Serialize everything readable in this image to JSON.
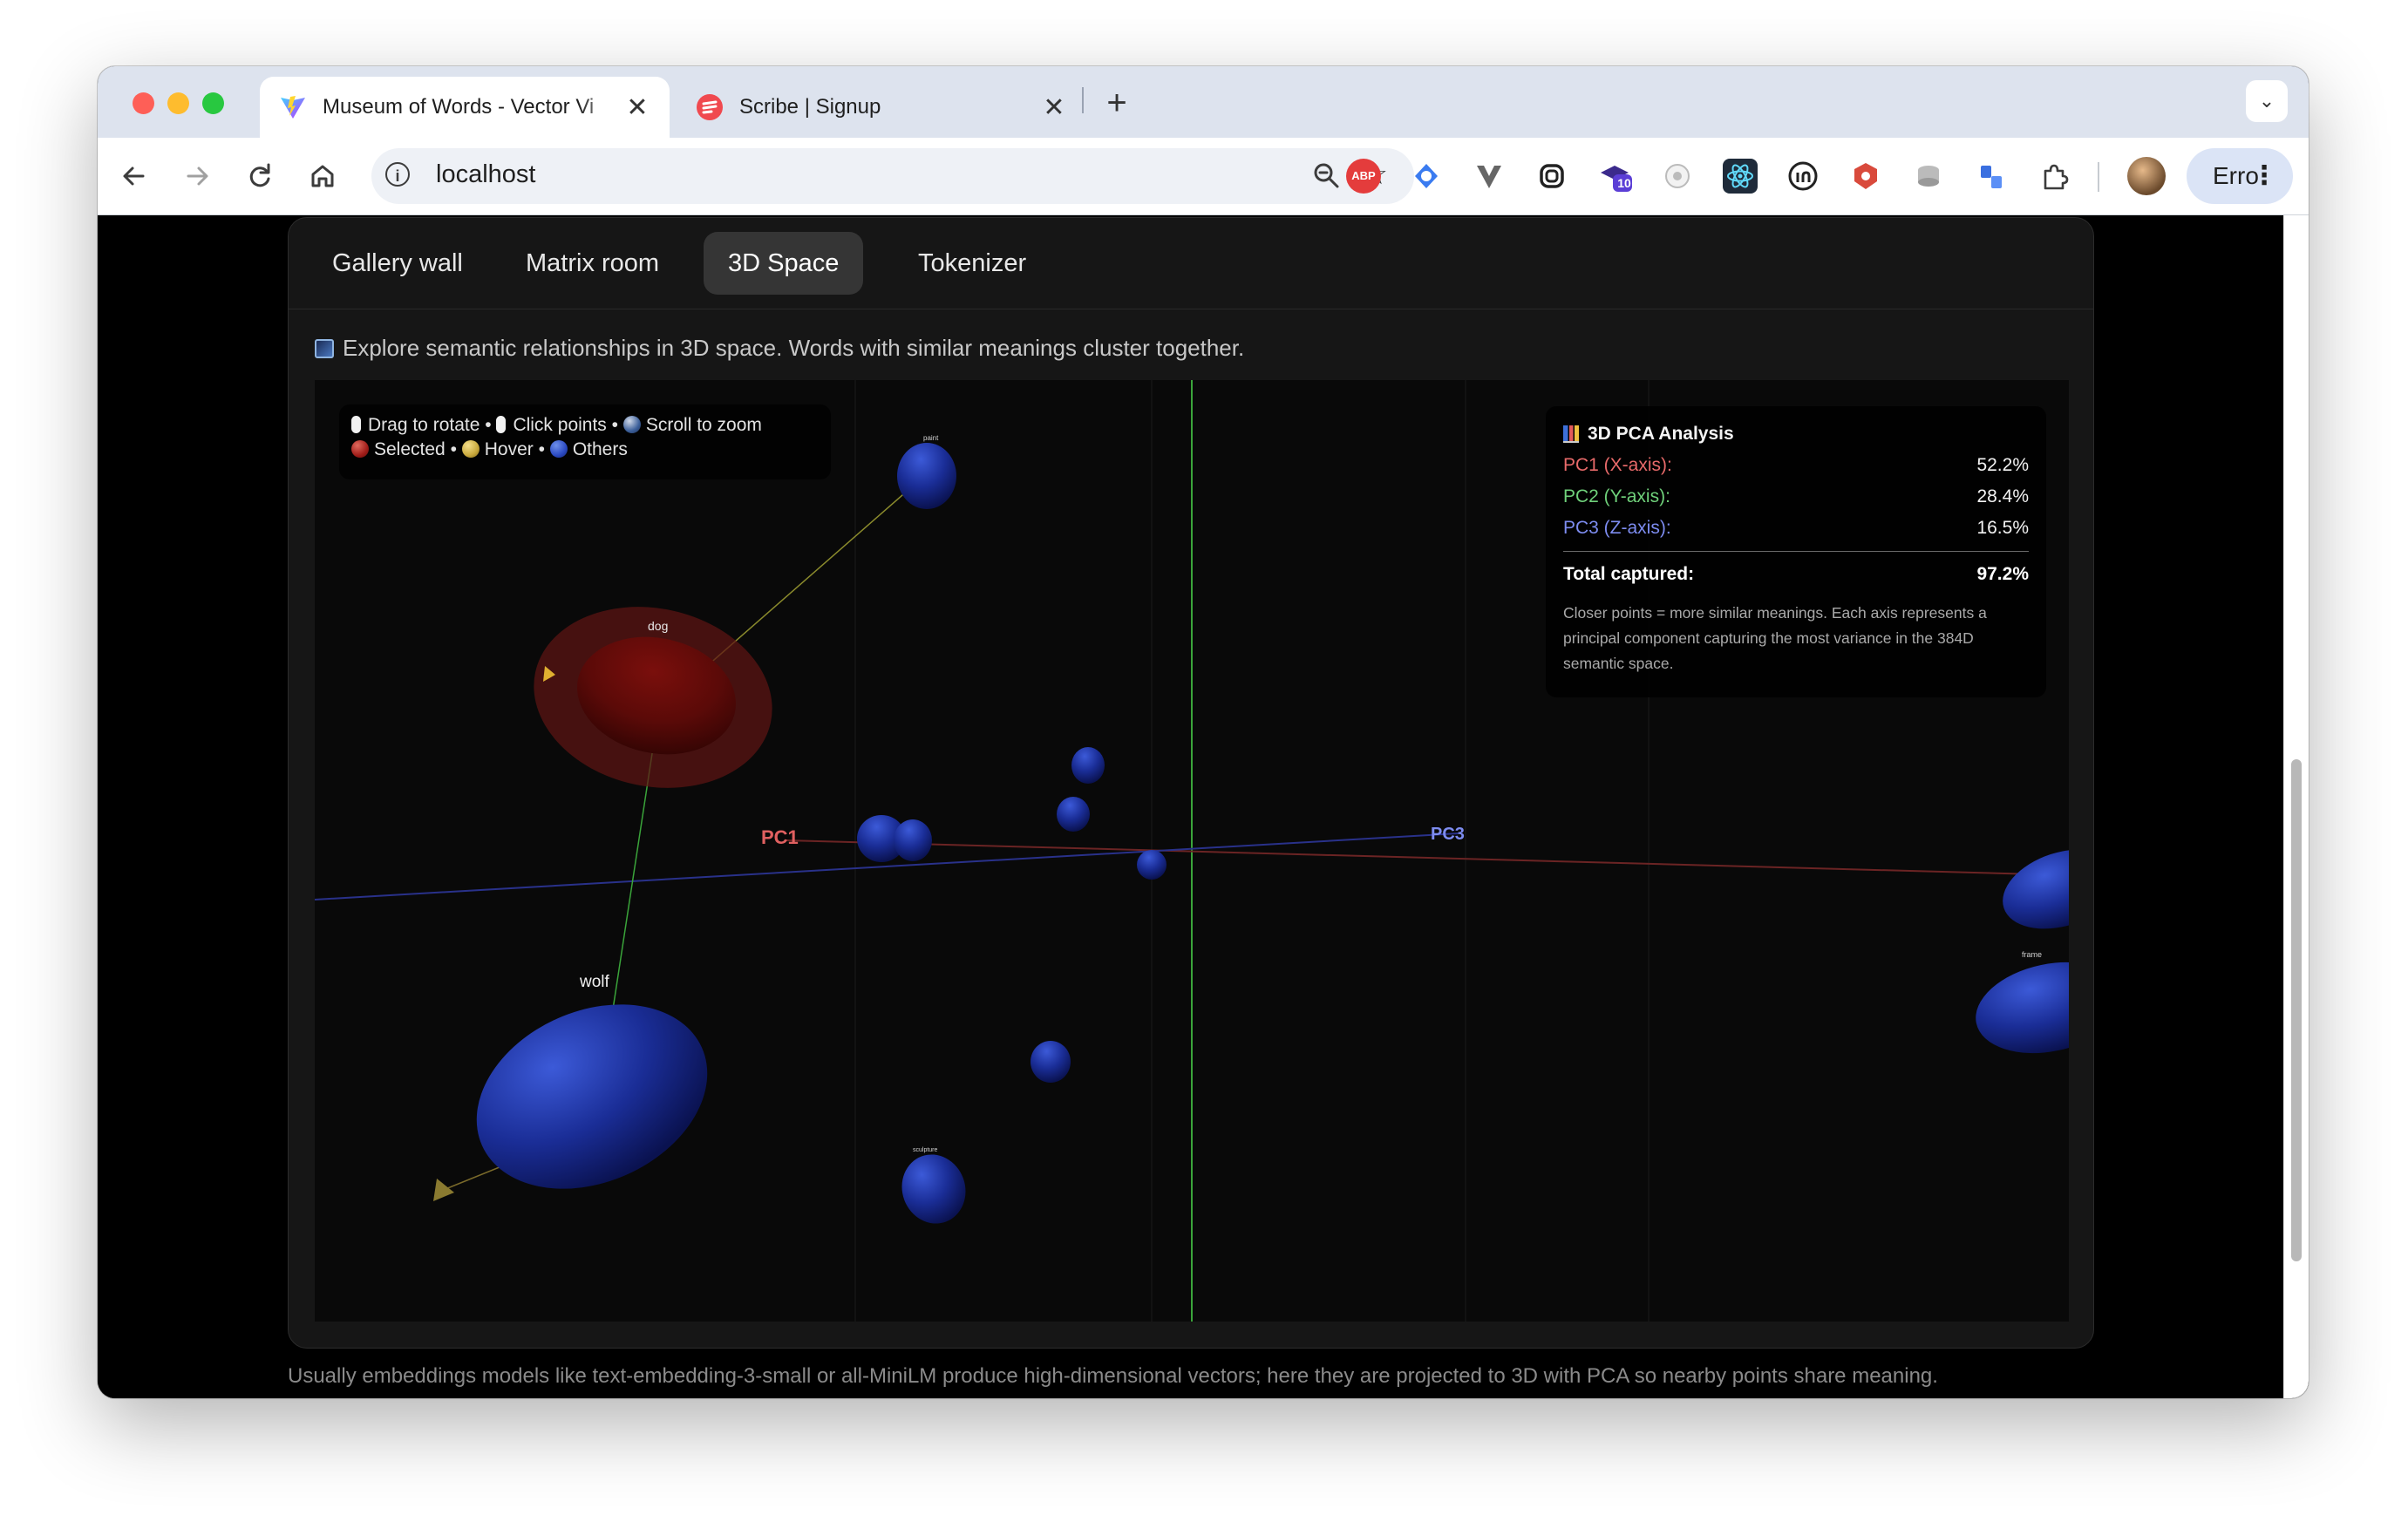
{
  "browser": {
    "tabs": [
      {
        "title": "Museum of Words - Vector Vi",
        "close": "✕",
        "favicon": "vite-icon"
      },
      {
        "title": "Scribe | Signup",
        "close": "✕",
        "favicon": "scribe-icon"
      }
    ],
    "new_tab": "+",
    "tab_search": "⌄",
    "address": "localhost",
    "extension_badge": "10",
    "extensions": [
      "ABP"
    ],
    "profile_name": "Erro",
    "menu": "⋮"
  },
  "app": {
    "tabs": [
      "Gallery wall",
      "Matrix room",
      "3D Space",
      "Tokenizer"
    ],
    "active_tab": "3D Space",
    "description": "Explore semantic relationships in 3D space. Words with similar meanings cluster together.",
    "legend": {
      "line1": [
        "Drag to rotate",
        "Click points",
        "Scroll to zoom"
      ],
      "line2": [
        "Selected",
        "Hover",
        "Others"
      ],
      "sep": " • "
    },
    "pca": {
      "title": "3D PCA Analysis",
      "rows": [
        {
          "label": "PC1 (X-axis):",
          "value": "52.2%",
          "color": "#e86a6a"
        },
        {
          "label": "PC2 (Y-axis):",
          "value": "28.4%",
          "color": "#6fd07a"
        },
        {
          "label": "PC3 (Z-axis):",
          "value": "16.5%",
          "color": "#7d8cf0"
        }
      ],
      "total_label": "Total captured:",
      "total_value": "97.2%",
      "note": "Closer points = more similar meanings. Each axis represents a principal component capturing the most variance in the 384D semantic space."
    },
    "axes": {
      "pc1": "PC1",
      "pc3": "PC3"
    },
    "words": [
      "dog",
      "wolf",
      "frame",
      "sculpture",
      "paint"
    ],
    "footer_text": "Usually embeddings models like text-embedding-3-small or all-MiniLM produce high-dimensional vectors; here they are projected to 3D with PCA so nearby points share meaning."
  },
  "colors": {
    "selected": "#8a1a16",
    "hover": "#c8a83c",
    "others": "#1f3cb0",
    "pc1": "#e06060",
    "pc2": "#5ac05a",
    "pc3": "#7d8cf0"
  }
}
